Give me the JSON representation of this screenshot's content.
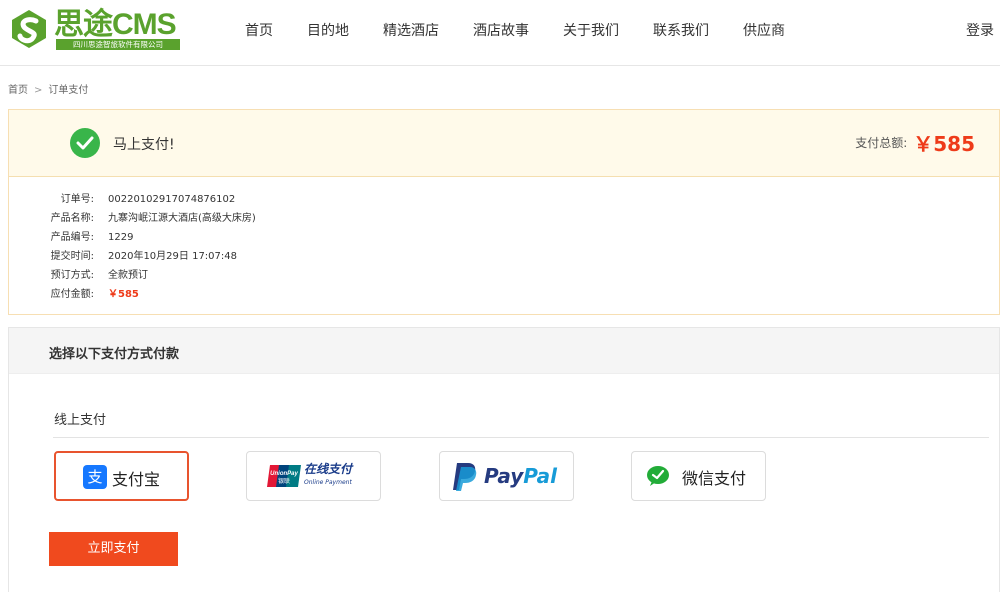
{
  "header": {
    "logo_text": "思途CMS",
    "logo_sub": "四川思途智旅软件有限公司",
    "nav": [
      "首页",
      "目的地",
      "精选酒店",
      "酒店故事",
      "关于我们",
      "联系我们",
      "供应商"
    ],
    "login": "登录"
  },
  "breadcrumb": {
    "home": "首页",
    "separator": ">",
    "current": "订单支付"
  },
  "success": {
    "message": "马上支付!",
    "total_label": "支付总额:",
    "total_value": "￥585"
  },
  "order": {
    "rows": [
      {
        "label": "订单号:",
        "value": "00220102917074876102"
      },
      {
        "label": "产品名称:",
        "value": "九寨沟岷江源大酒店(高级大床房)"
      },
      {
        "label": "产品编号:",
        "value": "1229"
      },
      {
        "label": "提交时间:",
        "value": "2020年10月29日 17:07:48"
      },
      {
        "label": "预订方式:",
        "value": "全款预订"
      },
      {
        "label": "应付金额:",
        "value": "￥585"
      }
    ]
  },
  "payment": {
    "title": "选择以下支付方式付款",
    "online_label": "线上支付",
    "options": {
      "alipay": {
        "icon": "支",
        "label": "支付宝"
      },
      "unionpay": {
        "logo_top": "UnionPay",
        "logo_bottom": "银联",
        "label": "在线支付",
        "sub": "Online Payment"
      },
      "paypal": {
        "label_pay": "Pay",
        "label_pal": "Pal"
      },
      "wechat": {
        "label": "微信支付"
      }
    },
    "selected": "alipay",
    "submit_label": "立即支付"
  },
  "colors": {
    "brand_green": "#5aa22d",
    "accent_red": "#ee3b1a",
    "button": "#f04a1e",
    "success_green": "#39b54a"
  }
}
